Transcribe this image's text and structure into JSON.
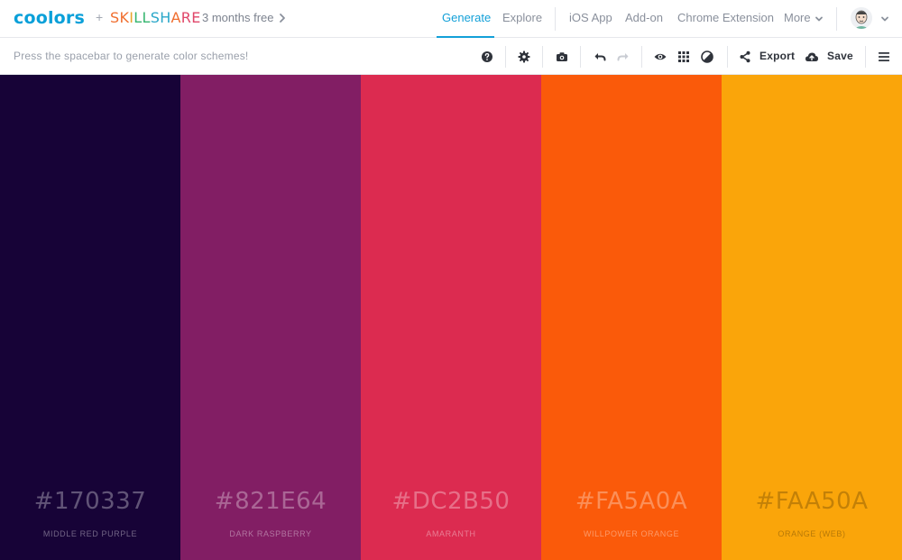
{
  "brand": {
    "logo": "coolors",
    "plus": "+",
    "partner_letters": [
      {
        "ch": "S",
        "color": "#f06e2f"
      },
      {
        "ch": "K",
        "color": "#f06e2f"
      },
      {
        "ch": "I",
        "color": "#e9a52b"
      },
      {
        "ch": "L",
        "color": "#35b56f"
      },
      {
        "ch": "L",
        "color": "#35b56f"
      },
      {
        "ch": "S",
        "color": "#2aa7c9"
      },
      {
        "ch": "H",
        "color": "#2aa7c9"
      },
      {
        "ch": "A",
        "color": "#f06e2f"
      },
      {
        "ch": "R",
        "color": "#e0476a"
      },
      {
        "ch": "E",
        "color": "#e0476a"
      }
    ],
    "promo": "3 months free"
  },
  "nav": {
    "generate": "Generate",
    "explore": "Explore",
    "ios_app": "iOS App",
    "add_on": "Add-on",
    "chrome_extension": "Chrome Extension",
    "more": "More"
  },
  "toolbar": {
    "hint": "Press the spacebar to generate color schemes!",
    "export": "Export",
    "save": "Save"
  },
  "palette": [
    {
      "hex": "#170337",
      "name": "MIDDLE RED PURPLE",
      "light": false
    },
    {
      "hex": "#821E64",
      "name": "DARK RASPBERRY",
      "light": false
    },
    {
      "hex": "#DC2B50",
      "name": "AMARANTH",
      "light": false
    },
    {
      "hex": "#FA5A0A",
      "name": "WILLPOWER ORANGE",
      "light": false
    },
    {
      "hex": "#FAA50A",
      "name": "ORANGE (WEB)",
      "light": true
    }
  ],
  "colors": {
    "accent": "#13a0d8",
    "logo": "#0aa0d9"
  },
  "icons": [
    "chevron-right-icon",
    "chevron-down-icon",
    "help-icon",
    "gear-icon",
    "camera-icon",
    "undo-icon",
    "redo-icon",
    "eye-icon",
    "grid-icon",
    "contrast-icon",
    "share-icon",
    "cloud-upload-icon",
    "hamburger-menu-icon"
  ]
}
